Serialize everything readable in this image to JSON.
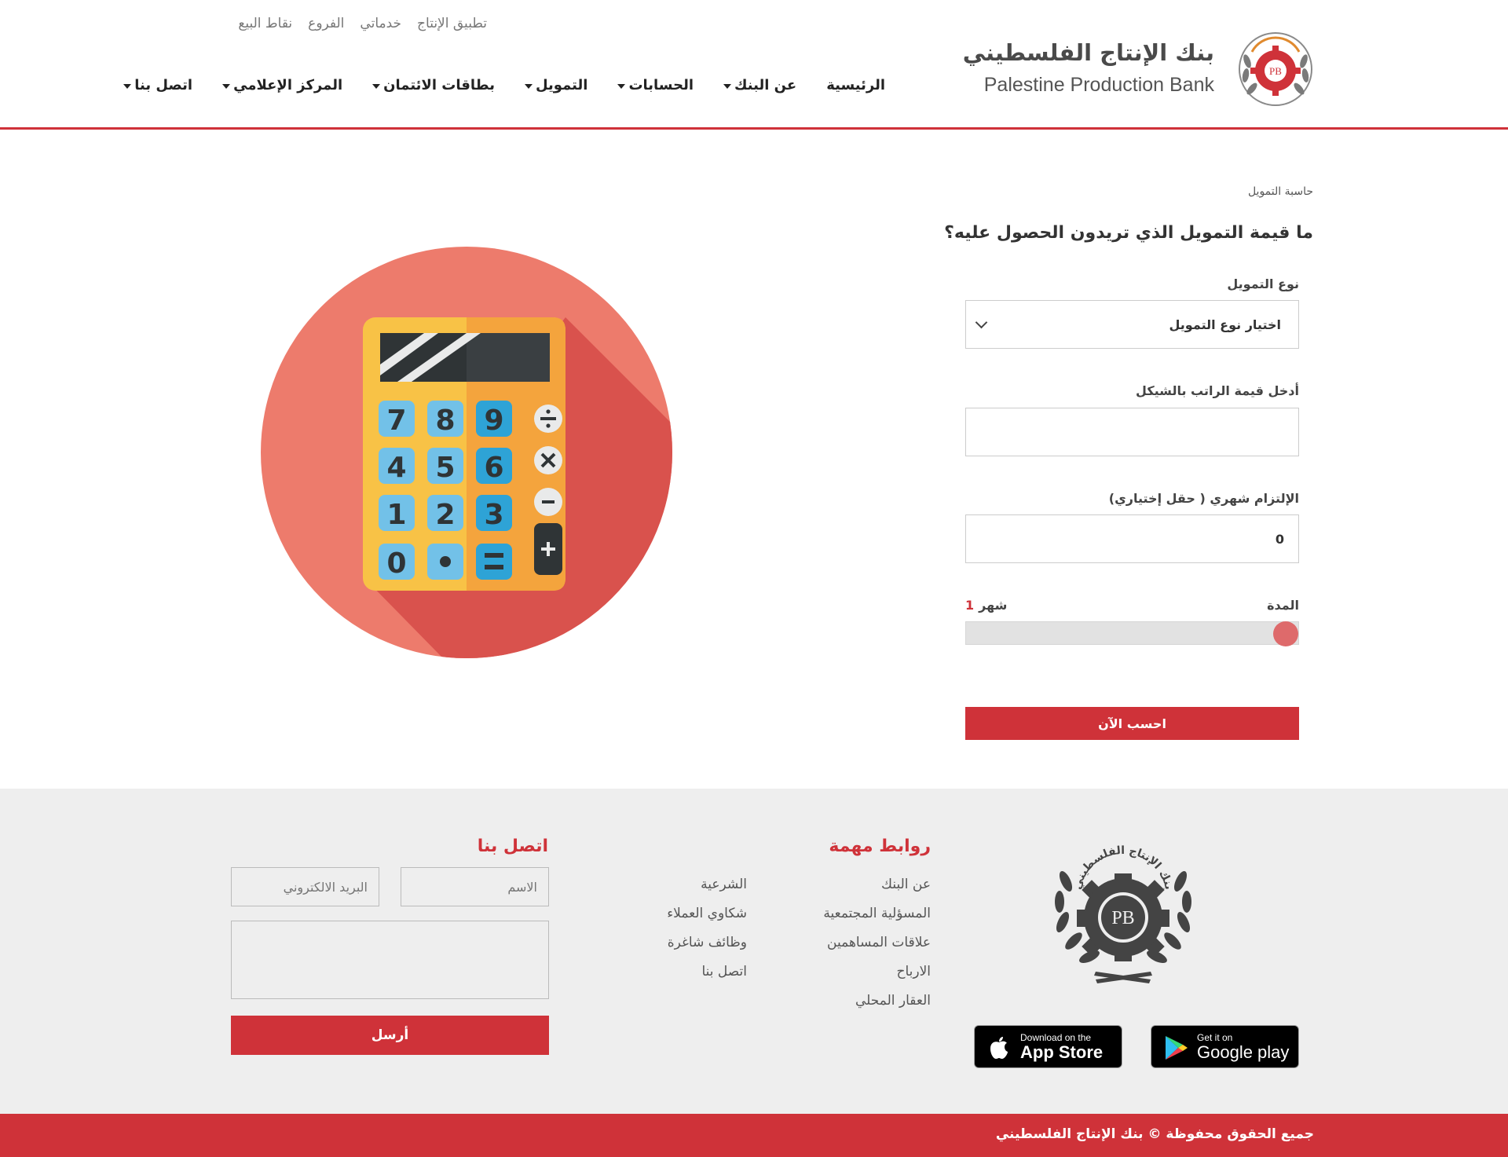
{
  "brand": {
    "name_ar": "بنك الإنتاج الفلسطيني",
    "name_en": "Palestine Production Bank",
    "accent": "#cf3239"
  },
  "top_links": [
    "تطبيق الإنتاج",
    "خدماتي",
    "الفروع",
    "نقاط البيع"
  ],
  "nav": [
    {
      "label": "الرئيسية",
      "dropdown": false
    },
    {
      "label": "عن البنك",
      "dropdown": true
    },
    {
      "label": "الحسابات",
      "dropdown": true
    },
    {
      "label": "التمويل",
      "dropdown": true
    },
    {
      "label": "بطاقات الائتمان",
      "dropdown": true
    },
    {
      "label": "المركز الإعلامي",
      "dropdown": true
    },
    {
      "label": "اتصل بنا",
      "dropdown": true
    }
  ],
  "calculator": {
    "breadcrumb": "حاسبة التمويل",
    "title": "ما قيمة التمويل الذي تريدون الحصول عليه؟",
    "type_label": "نوع التمويل",
    "type_selected": "اختيار نوع التمويل",
    "salary_label": "أدخل قيمة الراتب بالشيكل",
    "salary_value": "",
    "commitment_label": "الإلتزام شهري ( حقل إختياري)",
    "commitment_value": "0",
    "duration_label": "المدة",
    "duration_value": "1",
    "duration_unit": "شهر",
    "duration_level": 0,
    "submit_label": "احسب الآن"
  },
  "footer": {
    "links_heading": "روابط مهمة",
    "links_col1": [
      "عن البنك",
      "المسؤلية المجتمعية",
      "علاقات المساهمين",
      "الارباح",
      "العقار المحلي"
    ],
    "links_col2": [
      "الشرعية",
      "شكاوي العملاء",
      "وظائف شاغرة",
      "اتصل بنا"
    ],
    "contact_heading": "اتصل بنا",
    "name_placeholder": "الاسم",
    "email_placeholder": "البريد الالكتروني",
    "send_label": "أرسل",
    "seal_text": "بنك الإنتاج الفلسطيني",
    "google_small": "Get it on",
    "google_big": "Google play",
    "apple_small": "Download on the",
    "apple_big": "App Store",
    "copyright": "جميع الحقوق محفوظة © بنك الإنتاج الفلسطيني"
  }
}
